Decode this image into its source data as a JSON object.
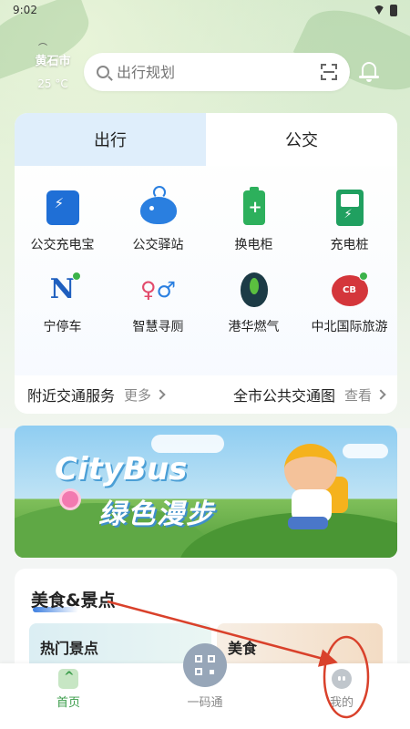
{
  "status_bar": {
    "time": "9:02"
  },
  "header": {
    "city": "黄石市",
    "temperature": "25 °C",
    "search_placeholder": "出行规划"
  },
  "tabs": [
    {
      "label": "出行",
      "active": true
    },
    {
      "label": "公交",
      "active": false
    }
  ],
  "services": [
    {
      "label": "公交充电宝",
      "icon": "power-bank-icon"
    },
    {
      "label": "公交驿站",
      "icon": "whale-icon"
    },
    {
      "label": "换电柜",
      "icon": "battery-icon"
    },
    {
      "label": "充电桩",
      "icon": "charging-station-icon"
    },
    {
      "label": "宁停车",
      "icon": "parking-icon"
    },
    {
      "label": "智慧寻厕",
      "icon": "toilet-icon"
    },
    {
      "label": "港华燃气",
      "icon": "gas-icon"
    },
    {
      "label": "中北国际旅游",
      "icon": "travel-icon"
    }
  ],
  "service_row": {
    "nearby_title": "附近交通服务",
    "nearby_more": "更多",
    "city_map_title": "全市公共交通图",
    "city_map_more": "查看"
  },
  "banner": {
    "title": "CityBus",
    "subtitle": "绿色漫步"
  },
  "food_section": {
    "title": "美食&景点",
    "cards": [
      {
        "label": "热门景点"
      },
      {
        "label": "美食"
      }
    ]
  },
  "bottom_nav": {
    "items": [
      {
        "label": "首页",
        "active": true
      },
      {
        "label": "一码通",
        "active": false
      },
      {
        "label": "我的",
        "active": false
      }
    ]
  },
  "colors": {
    "accent_green": "#3a9c4a",
    "tab_active_bg": "#dfeefb",
    "annotation_red": "#d9412b"
  }
}
